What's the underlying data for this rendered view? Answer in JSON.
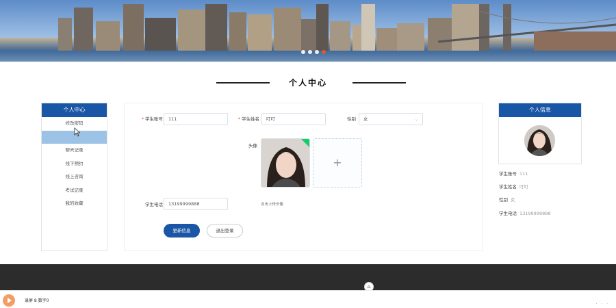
{
  "section": {
    "title": "个人中心"
  },
  "left_menu": {
    "header": "个人中心",
    "items": [
      {
        "label": "修改密码"
      },
      {
        "label": ""
      },
      {
        "label": "聊天记录"
      },
      {
        "label": "线下预约"
      },
      {
        "label": "线上咨询"
      },
      {
        "label": "考试记录"
      },
      {
        "label": "我的收藏"
      }
    ],
    "active_index": 1
  },
  "form": {
    "account_label": "学生账号",
    "account_value": "111",
    "name_label": "学生姓名",
    "name_value": "叮叮",
    "gender_label": "性别",
    "gender_value": "女",
    "avatar_label": "头像",
    "upload_plus": "+",
    "phone_label": "学生电话",
    "phone_value": "13199999888",
    "upload_hint": "点击上传头像",
    "update_button": "更新信息",
    "logout_button": "退出登录"
  },
  "profile": {
    "header": "个人信息",
    "rows": [
      {
        "label": "学生账号",
        "value": "111"
      },
      {
        "label": "学生姓名",
        "value": "叮叮"
      },
      {
        "label": "性别",
        "value": "女"
      },
      {
        "label": "学生电话",
        "value": "13199999888"
      }
    ]
  },
  "bottom_bar": {
    "text": "录屏 8 数字0",
    "top_icon": "⌂"
  },
  "colors": {
    "primary": "#1a56a6",
    "active_item": "#9cc2e6",
    "footer": "#2c2c2c"
  }
}
